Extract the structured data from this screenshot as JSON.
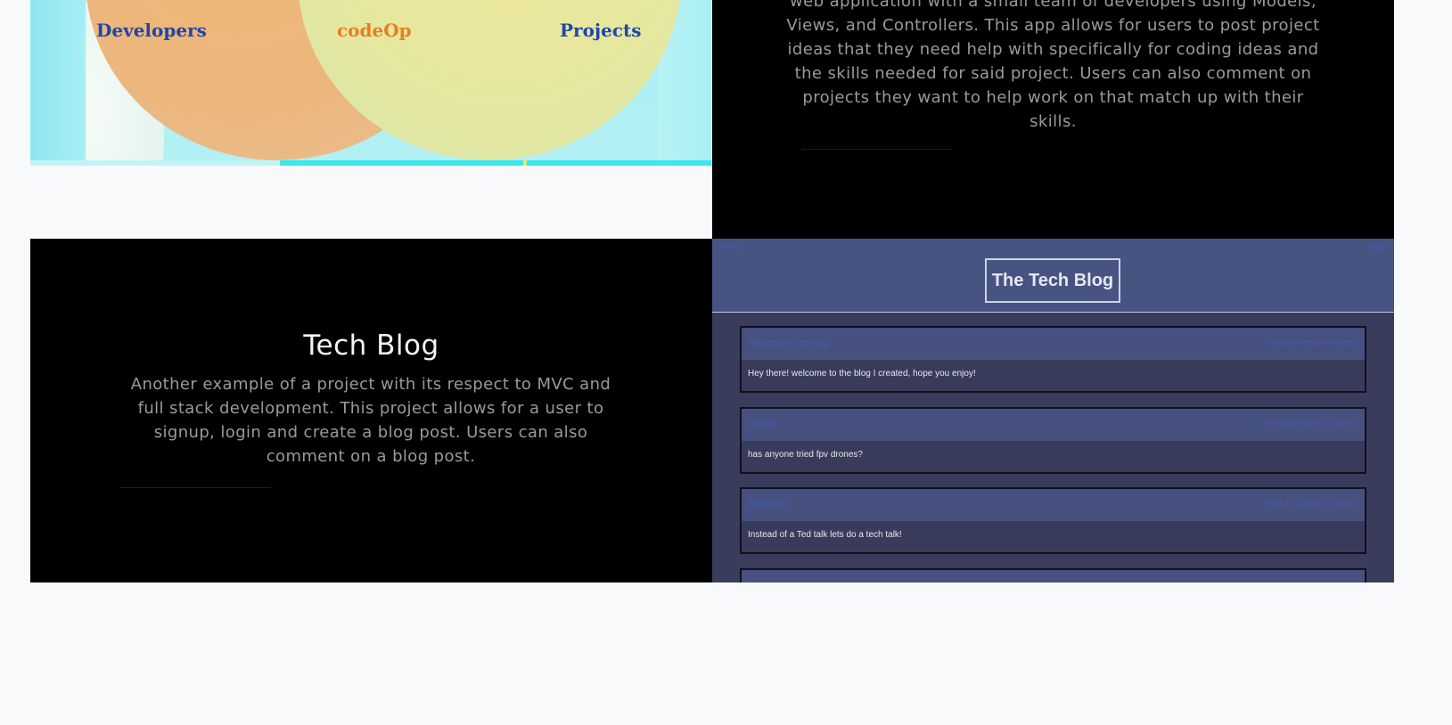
{
  "project_codeop": {
    "image": {
      "labels": {
        "left": "Developers",
        "middle": "codeOp",
        "right": "Projects"
      },
      "colors": {
        "blue": "#1f46a8",
        "orange": "#ea7d22"
      }
    },
    "description": "web application with a small team of developers using Models, Views, and Controllers. This app allows for users to post project ideas that they need help with specifically for coding ideas and the skills needed for said project. Users can also comment on projects they want to help work on that match up with their skills."
  },
  "project_techblog": {
    "title": "Tech Blog",
    "description": "Another example of a project with its respect to MVC and full stack development. This project allows for a user to signup, login and create a blog post. Users can also comment on a blog post.",
    "screenshot": {
      "nav": {
        "home": "home",
        "login": "login"
      },
      "site_title": "The Tech Blog",
      "posts": [
        {
          "title": "Welcome to my blog",
          "meta": "Posted by welliams on 4/28/2022",
          "body": "Hey there! welcome to the blog I created, hope you enjoy!"
        },
        {
          "title": "Drones",
          "meta": "Posted by georgeh23 on 4/28/2022",
          "body": "has anyone tried fpv drones?"
        },
        {
          "title": "Tech talks",
          "meta": "Posted by Cynthia88 on 4/28/2022",
          "body": "Instead of a Ted talk lets do a tech talk!"
        }
      ]
    }
  }
}
